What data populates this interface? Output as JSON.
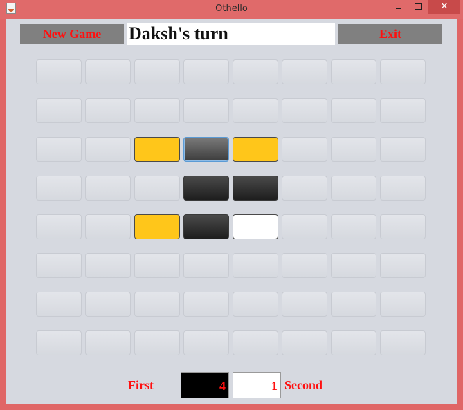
{
  "window": {
    "title": "Othello",
    "close_glyph": "✕"
  },
  "toolbar": {
    "new_game_label": "New Game",
    "status_text": "Daksh's turn",
    "exit_label": "Exit"
  },
  "board": {
    "size": 8,
    "rows": [
      [
        "empty",
        "empty",
        "empty",
        "empty",
        "empty",
        "empty",
        "empty",
        "empty"
      ],
      [
        "empty",
        "empty",
        "empty",
        "empty",
        "empty",
        "empty",
        "empty",
        "empty"
      ],
      [
        "empty",
        "empty",
        "hint",
        "focus",
        "hint",
        "empty",
        "empty",
        "empty"
      ],
      [
        "empty",
        "empty",
        "empty",
        "black",
        "black",
        "empty",
        "empty",
        "empty"
      ],
      [
        "empty",
        "empty",
        "hint",
        "black",
        "white",
        "empty",
        "empty",
        "empty"
      ],
      [
        "empty",
        "empty",
        "empty",
        "empty",
        "empty",
        "empty",
        "empty",
        "empty"
      ],
      [
        "empty",
        "empty",
        "empty",
        "empty",
        "empty",
        "empty",
        "empty",
        "empty"
      ],
      [
        "empty",
        "empty",
        "empty",
        "empty",
        "empty",
        "empty",
        "empty",
        "empty"
      ]
    ],
    "colors": {
      "black": "#1e1e1e",
      "white": "#ffffff",
      "hint": "#ffc61a",
      "empty": "#dcdee3"
    }
  },
  "score": {
    "first_label": "First",
    "first_value": "4",
    "second_label": "Second",
    "second_value": "1"
  },
  "colors": {
    "accent_text": "#ff1010",
    "button_bg": "#808080",
    "frame": "#e06666"
  }
}
